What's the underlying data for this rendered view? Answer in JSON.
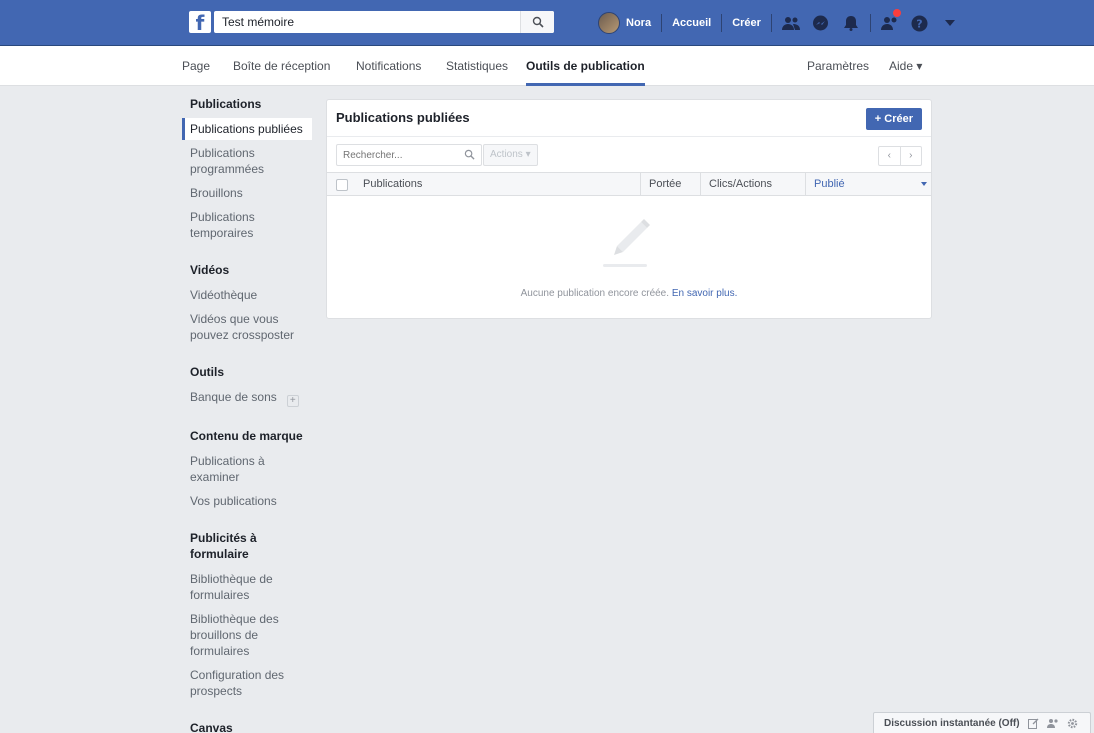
{
  "topbar": {
    "logo": "f",
    "search_value": "Test mémoire",
    "user_name": "Nora",
    "home_label": "Accueil",
    "create_label": "Créer",
    "brand_color": "#4267b2"
  },
  "tabs": [
    {
      "label": "Page"
    },
    {
      "label": "Boîte de réception"
    },
    {
      "label": "Notifications"
    },
    {
      "label": "Statistiques"
    },
    {
      "label": "Outils de publication",
      "active": true
    },
    {
      "label": "Paramètres"
    },
    {
      "label": "Aide ▾"
    }
  ],
  "sidebar": {
    "sections": [
      {
        "title": "Publications",
        "items": [
          "Publications publiées",
          "Publications programmées",
          "Brouillons",
          "Publications temporaires"
        ]
      },
      {
        "title": "Vidéos",
        "items": [
          "Vidéothèque",
          "Vidéos que vous pouvez crossposter"
        ]
      },
      {
        "title": "Outils",
        "items": [
          "Banque de sons"
        ]
      },
      {
        "title": "Contenu de marque",
        "items": [
          "Publications à examiner",
          "Vos publications"
        ]
      },
      {
        "title": "Publicités à formulaire",
        "items": [
          "Bibliothèque de formulaires",
          "Bibliothèque des brouillons de formulaires",
          "Configuration des prospects"
        ]
      },
      {
        "title": "Canvas",
        "items": []
      }
    ],
    "active_item": "Publications publiées"
  },
  "card": {
    "title": "Publications publiées",
    "create_button": "+ Créer",
    "search_placeholder": "Rechercher...",
    "actions_label": "Actions ▾",
    "pager_prev": "‹",
    "pager_next": "›",
    "columns": [
      "Publications",
      "Portée",
      "Clics/Actions",
      "Publié"
    ],
    "empty_text": "Aucune publication encore créée.",
    "learn_more": "En savoir plus."
  },
  "chat": {
    "label": "Discussion instantanée (Off)"
  }
}
